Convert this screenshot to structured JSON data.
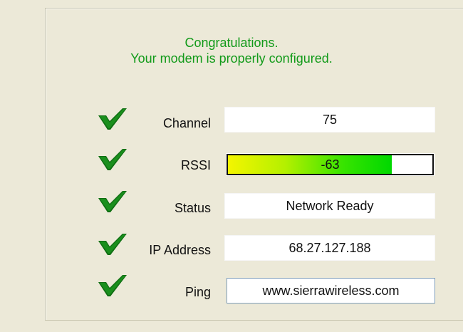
{
  "message": {
    "line1": "Congratulations.",
    "line2": "Your modem is properly configured."
  },
  "rows": {
    "channel": {
      "label": "Channel",
      "value": "75"
    },
    "rssi": {
      "label": "RSSI",
      "value": "-63",
      "signal_fraction": 0.8
    },
    "status": {
      "label": "Status",
      "value": "Network Ready"
    },
    "ip_address": {
      "label": "IP Address",
      "value": "68.27.127.188"
    },
    "ping": {
      "label": "Ping",
      "value": "www.sierrawireless.com"
    }
  },
  "colors": {
    "message": "#119a19",
    "check": "#0f6e12",
    "background": "#ece9d8"
  },
  "icons": {
    "check": "green-check-icon"
  }
}
